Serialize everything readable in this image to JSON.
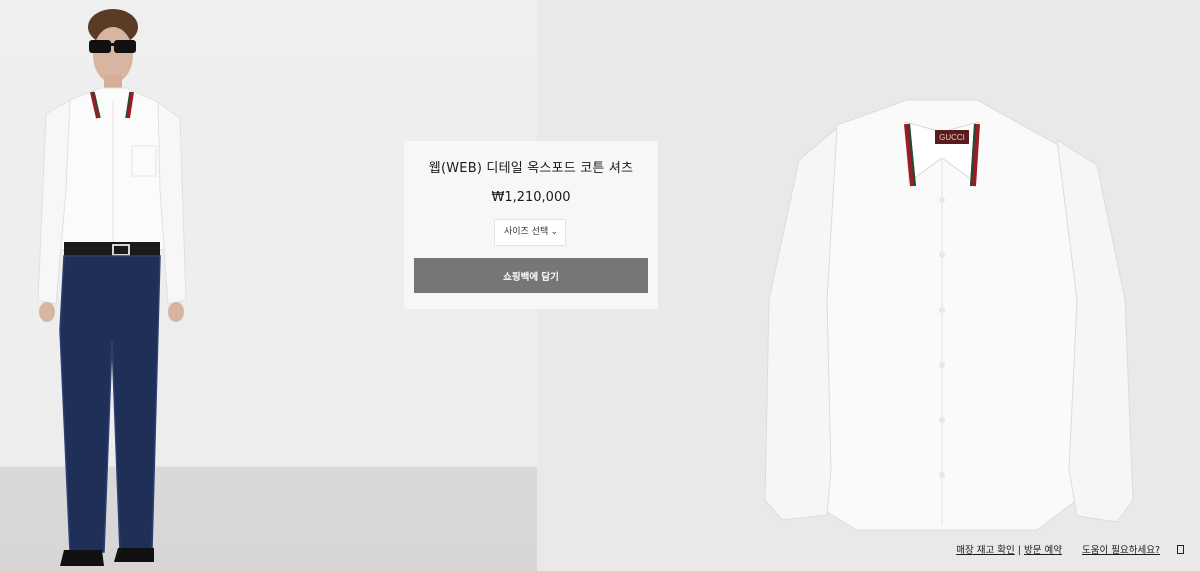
{
  "product": {
    "title": "웹(WEB) 디테일 옥스포드 코튼 셔츠",
    "price": "₩1,210,000"
  },
  "size_select": {
    "label": "사이즈 선택",
    "icon": "chevron-down-icon"
  },
  "actions": {
    "add_to_bag": "쇼핑백에 담기"
  },
  "footer": {
    "store_check": "매장 재고 확인",
    "separator": " | ",
    "visit_reservation": "방문 예약",
    "help": "도움이 필요하세요?",
    "chat_icon": "chat-icon"
  },
  "product_image": {
    "collar_brand": "GUCCI"
  },
  "colors": {
    "button_bg": "#767676",
    "card_bg": "#f7f7f7",
    "web_stripe_red": "#9b1b22",
    "web_stripe_green": "#1e4d34"
  }
}
